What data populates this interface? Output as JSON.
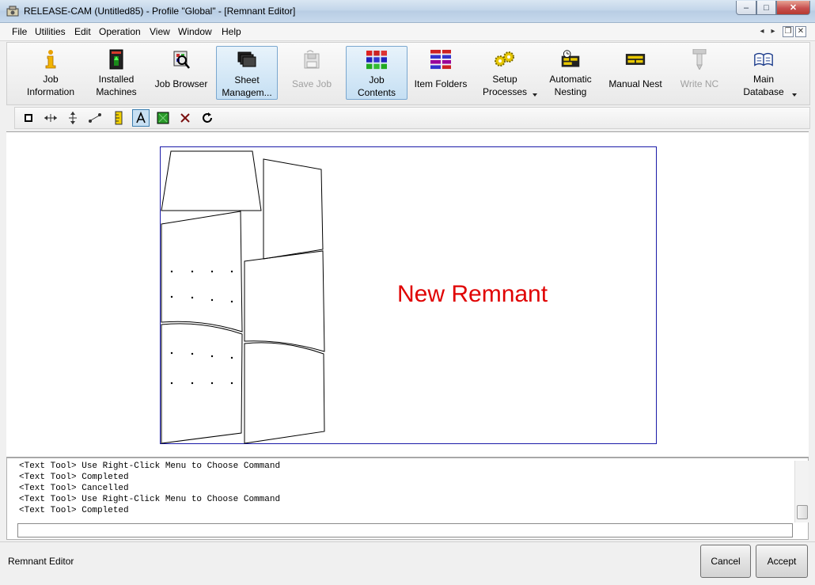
{
  "window": {
    "title": "RELEASE-CAM (Untitled85) - Profile \"Global\" - [Remnant Editor]",
    "minimize": "–",
    "maximize": "□",
    "close": "✕"
  },
  "menu": {
    "items": [
      "File",
      "Utilities",
      "Edit",
      "Operation",
      "View",
      "Window",
      "Help"
    ],
    "mdi_prev": "◂",
    "mdi_next": "▸",
    "mdi_restore": "❐",
    "mdi_close": "✕"
  },
  "toolbar": {
    "buttons": [
      {
        "line1": "Job",
        "line2": "Information",
        "icon": "info-icon"
      },
      {
        "line1": "Installed",
        "line2": "Machines",
        "icon": "machine-icon"
      },
      {
        "line1": "Job Browser",
        "line2": "",
        "icon": "browser-icon"
      },
      {
        "line1": "Sheet",
        "line2": "Managem...",
        "icon": "sheets-icon"
      },
      {
        "line1": "Save Job",
        "line2": "",
        "icon": "save-icon"
      },
      {
        "line1": "Job",
        "line2": "Contents",
        "icon": "grid-icon"
      },
      {
        "line1": "Item Folders",
        "line2": "",
        "icon": "folders-icon"
      },
      {
        "line1": "Setup",
        "line2": "Processes",
        "icon": "gears-icon"
      },
      {
        "line1": "Automatic",
        "line2": "Nesting",
        "icon": "auto-nest-icon"
      },
      {
        "line1": "Manual Nest",
        "line2": "",
        "icon": "manual-nest-icon"
      },
      {
        "line1": "Write NC",
        "line2": "",
        "icon": "write-nc-icon"
      },
      {
        "line1": "Main",
        "line2": "Database",
        "icon": "database-icon"
      }
    ]
  },
  "tools": [
    "select-tool-icon",
    "horizontal-dimension-icon",
    "vertical-dimension-icon",
    "line-tool-icon",
    "ruler-icon",
    "text-tool-icon",
    "fill-icon",
    "delete-icon",
    "refresh-icon"
  ],
  "canvas": {
    "remnant_label": "New Remnant"
  },
  "console": {
    "lines": [
      "<Text Tool> Use Right-Click Menu to Choose Command",
      "<Text Tool> Completed",
      "<Text Tool> Cancelled",
      "<Text Tool> Use Right-Click Menu to Choose Command",
      "<Text Tool> Completed"
    ],
    "input_value": ""
  },
  "status": {
    "text": "Remnant Editor",
    "cancel_label": "Cancel",
    "accept_label": "Accept"
  }
}
